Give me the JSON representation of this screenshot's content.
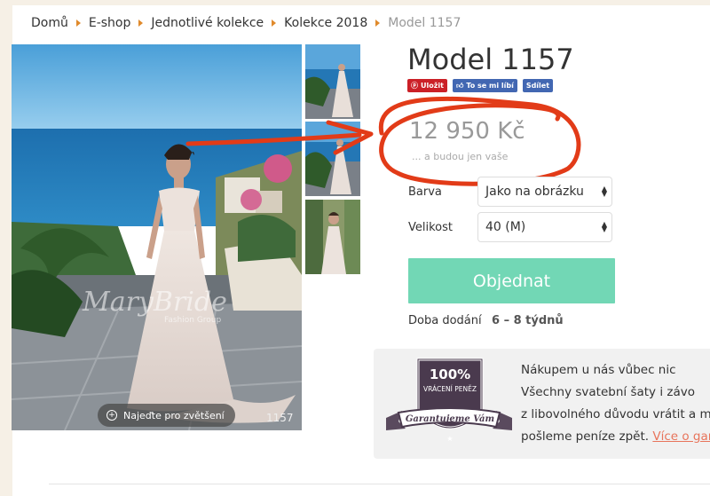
{
  "breadcrumb": [
    "Domů",
    "E-shop",
    "Jednotlivé kolekce",
    "Kolekce 2018",
    "Model 1157"
  ],
  "product": {
    "title": "Model 1157",
    "price": "12 950 Kč",
    "slogan": "... a budou jen vaše"
  },
  "social": {
    "pin": "Uložit",
    "like": "To se mi líbí",
    "share": "Sdílet"
  },
  "image": {
    "zoom_label": "Najeďte pro zvětšení",
    "number": "1157",
    "watermark": "MaryBride",
    "watermark_sub": "Fashion Group"
  },
  "options": {
    "color_label": "Barva",
    "color_value": "Jako na obrázku",
    "size_label": "Velikost",
    "size_value": "40 (M)"
  },
  "order_button": "Objednat",
  "delivery": {
    "label": "Doba dodání",
    "value": "6 – 8 týdnů"
  },
  "guarantee": {
    "badge_percent": "100%",
    "badge_line": "VRÁCENÍ PENĚZ",
    "badge_ribbon": "Garantujeme Vám",
    "lines": [
      "Nákupem u nás vůbec nic",
      "Všechny svatební šaty i závo",
      "z libovolného důvodu vrátit a my",
      "pošleme peníze zpět."
    ],
    "link": "Více o garan"
  },
  "colors": {
    "accent_orange": "#e08a2c",
    "order_green": "#72d7b5",
    "annotation_red": "#e23b18",
    "link": "#e8745b"
  }
}
